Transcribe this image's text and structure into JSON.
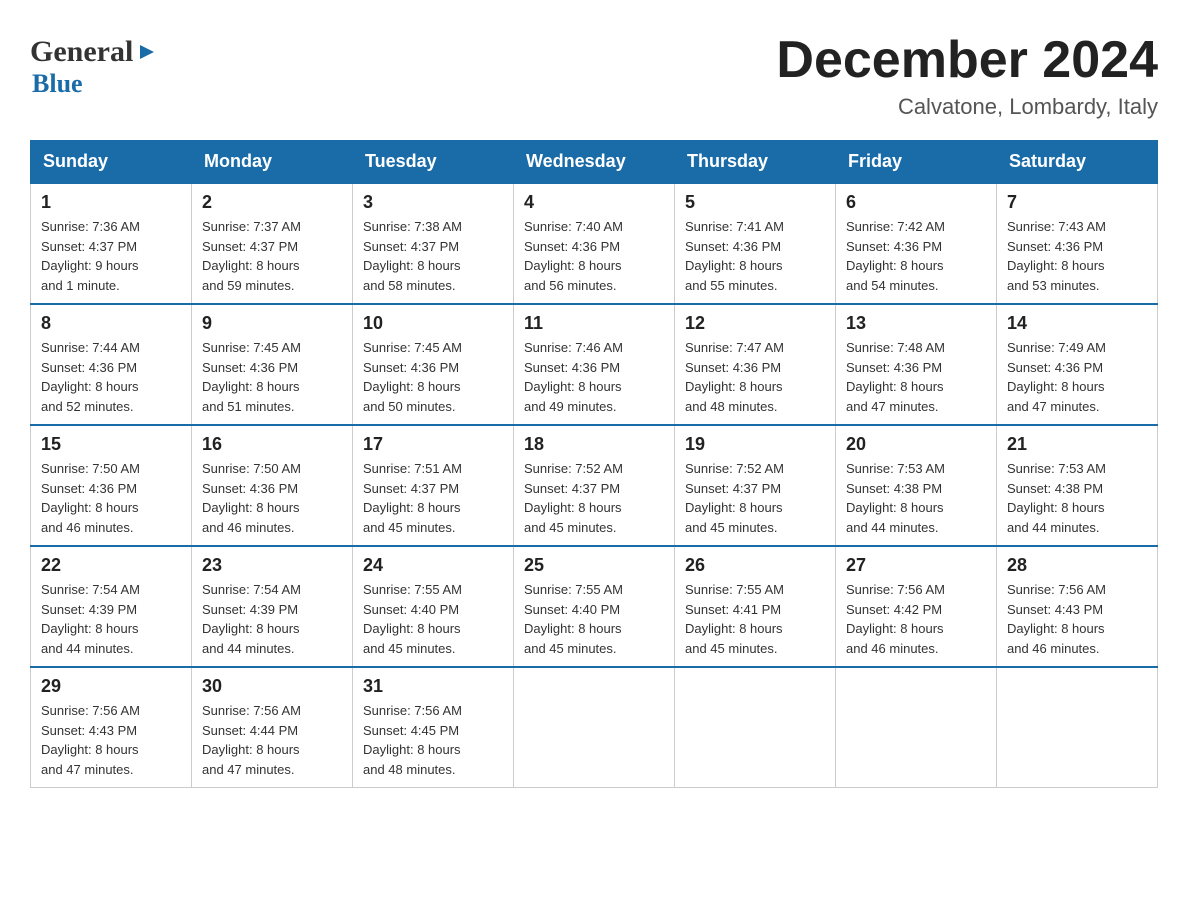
{
  "header": {
    "logo_general": "General",
    "logo_blue": "Blue",
    "month_title": "December 2024",
    "location": "Calvatone, Lombardy, Italy"
  },
  "days_of_week": [
    "Sunday",
    "Monday",
    "Tuesday",
    "Wednesday",
    "Thursday",
    "Friday",
    "Saturday"
  ],
  "weeks": [
    [
      {
        "day": "1",
        "sunrise": "7:36 AM",
        "sunset": "4:37 PM",
        "daylight": "9 hours and 1 minute."
      },
      {
        "day": "2",
        "sunrise": "7:37 AM",
        "sunset": "4:37 PM",
        "daylight": "8 hours and 59 minutes."
      },
      {
        "day": "3",
        "sunrise": "7:38 AM",
        "sunset": "4:37 PM",
        "daylight": "8 hours and 58 minutes."
      },
      {
        "day": "4",
        "sunrise": "7:40 AM",
        "sunset": "4:36 PM",
        "daylight": "8 hours and 56 minutes."
      },
      {
        "day": "5",
        "sunrise": "7:41 AM",
        "sunset": "4:36 PM",
        "daylight": "8 hours and 55 minutes."
      },
      {
        "day": "6",
        "sunrise": "7:42 AM",
        "sunset": "4:36 PM",
        "daylight": "8 hours and 54 minutes."
      },
      {
        "day": "7",
        "sunrise": "7:43 AM",
        "sunset": "4:36 PM",
        "daylight": "8 hours and 53 minutes."
      }
    ],
    [
      {
        "day": "8",
        "sunrise": "7:44 AM",
        "sunset": "4:36 PM",
        "daylight": "8 hours and 52 minutes."
      },
      {
        "day": "9",
        "sunrise": "7:45 AM",
        "sunset": "4:36 PM",
        "daylight": "8 hours and 51 minutes."
      },
      {
        "day": "10",
        "sunrise": "7:45 AM",
        "sunset": "4:36 PM",
        "daylight": "8 hours and 50 minutes."
      },
      {
        "day": "11",
        "sunrise": "7:46 AM",
        "sunset": "4:36 PM",
        "daylight": "8 hours and 49 minutes."
      },
      {
        "day": "12",
        "sunrise": "7:47 AM",
        "sunset": "4:36 PM",
        "daylight": "8 hours and 48 minutes."
      },
      {
        "day": "13",
        "sunrise": "7:48 AM",
        "sunset": "4:36 PM",
        "daylight": "8 hours and 47 minutes."
      },
      {
        "day": "14",
        "sunrise": "7:49 AM",
        "sunset": "4:36 PM",
        "daylight": "8 hours and 47 minutes."
      }
    ],
    [
      {
        "day": "15",
        "sunrise": "7:50 AM",
        "sunset": "4:36 PM",
        "daylight": "8 hours and 46 minutes."
      },
      {
        "day": "16",
        "sunrise": "7:50 AM",
        "sunset": "4:36 PM",
        "daylight": "8 hours and 46 minutes."
      },
      {
        "day": "17",
        "sunrise": "7:51 AM",
        "sunset": "4:37 PM",
        "daylight": "8 hours and 45 minutes."
      },
      {
        "day": "18",
        "sunrise": "7:52 AM",
        "sunset": "4:37 PM",
        "daylight": "8 hours and 45 minutes."
      },
      {
        "day": "19",
        "sunrise": "7:52 AM",
        "sunset": "4:37 PM",
        "daylight": "8 hours and 45 minutes."
      },
      {
        "day": "20",
        "sunrise": "7:53 AM",
        "sunset": "4:38 PM",
        "daylight": "8 hours and 44 minutes."
      },
      {
        "day": "21",
        "sunrise": "7:53 AM",
        "sunset": "4:38 PM",
        "daylight": "8 hours and 44 minutes."
      }
    ],
    [
      {
        "day": "22",
        "sunrise": "7:54 AM",
        "sunset": "4:39 PM",
        "daylight": "8 hours and 44 minutes."
      },
      {
        "day": "23",
        "sunrise": "7:54 AM",
        "sunset": "4:39 PM",
        "daylight": "8 hours and 44 minutes."
      },
      {
        "day": "24",
        "sunrise": "7:55 AM",
        "sunset": "4:40 PM",
        "daylight": "8 hours and 45 minutes."
      },
      {
        "day": "25",
        "sunrise": "7:55 AM",
        "sunset": "4:40 PM",
        "daylight": "8 hours and 45 minutes."
      },
      {
        "day": "26",
        "sunrise": "7:55 AM",
        "sunset": "4:41 PM",
        "daylight": "8 hours and 45 minutes."
      },
      {
        "day": "27",
        "sunrise": "7:56 AM",
        "sunset": "4:42 PM",
        "daylight": "8 hours and 46 minutes."
      },
      {
        "day": "28",
        "sunrise": "7:56 AM",
        "sunset": "4:43 PM",
        "daylight": "8 hours and 46 minutes."
      }
    ],
    [
      {
        "day": "29",
        "sunrise": "7:56 AM",
        "sunset": "4:43 PM",
        "daylight": "8 hours and 47 minutes."
      },
      {
        "day": "30",
        "sunrise": "7:56 AM",
        "sunset": "4:44 PM",
        "daylight": "8 hours and 47 minutes."
      },
      {
        "day": "31",
        "sunrise": "7:56 AM",
        "sunset": "4:45 PM",
        "daylight": "8 hours and 48 minutes."
      },
      null,
      null,
      null,
      null
    ]
  ],
  "labels": {
    "sunrise": "Sunrise:",
    "sunset": "Sunset:",
    "daylight": "Daylight:"
  }
}
